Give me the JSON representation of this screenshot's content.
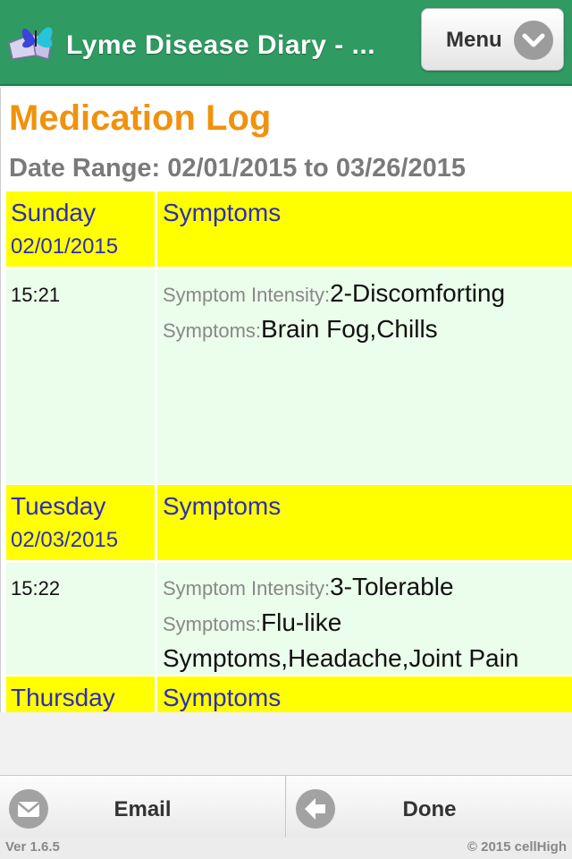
{
  "app": {
    "title": "Lyme Disease Diary - ...",
    "logo_icon": "butterfly-book-icon",
    "menu_label": "Menu",
    "menu_icon": "chevron-down-icon"
  },
  "page": {
    "title": "Medication Log",
    "date_range_label": "Date Range:",
    "date_range_value": "02/01/2015 to 03/26/2015"
  },
  "entries": [
    {
      "day": "Sunday",
      "date": "02/01/2015",
      "category": "Symptoms",
      "time": "15:21",
      "intensity_label": "Symptom Intensity:",
      "intensity_value": "2-Discomforting",
      "symptoms_label": "Symptoms:",
      "symptoms_value": "Brain Fog,Chills"
    },
    {
      "day": "Tuesday",
      "date": "02/03/2015",
      "category": "Symptoms",
      "time": "15:22",
      "intensity_label": "Symptom Intensity:",
      "intensity_value": "3-Tolerable",
      "symptoms_label": "Symptoms:",
      "symptoms_value": "Flu-like Symptoms,Headache,Joint Pain"
    },
    {
      "day": "Thursday",
      "category": "Symptoms"
    }
  ],
  "footer": {
    "email_label": "Email",
    "email_icon": "envelope-icon",
    "done_label": "Done",
    "done_icon": "back-arrow-icon"
  },
  "status": {
    "version": "Ver 1.6.5",
    "copyright": "© 2015 cellHigh"
  },
  "colors": {
    "header": "#2f9a62",
    "title_orange": "#f0920e",
    "day_header_bg": "#ffff00",
    "day_text_blue": "#2d2db8",
    "entry_bg": "#ebfdeb"
  }
}
